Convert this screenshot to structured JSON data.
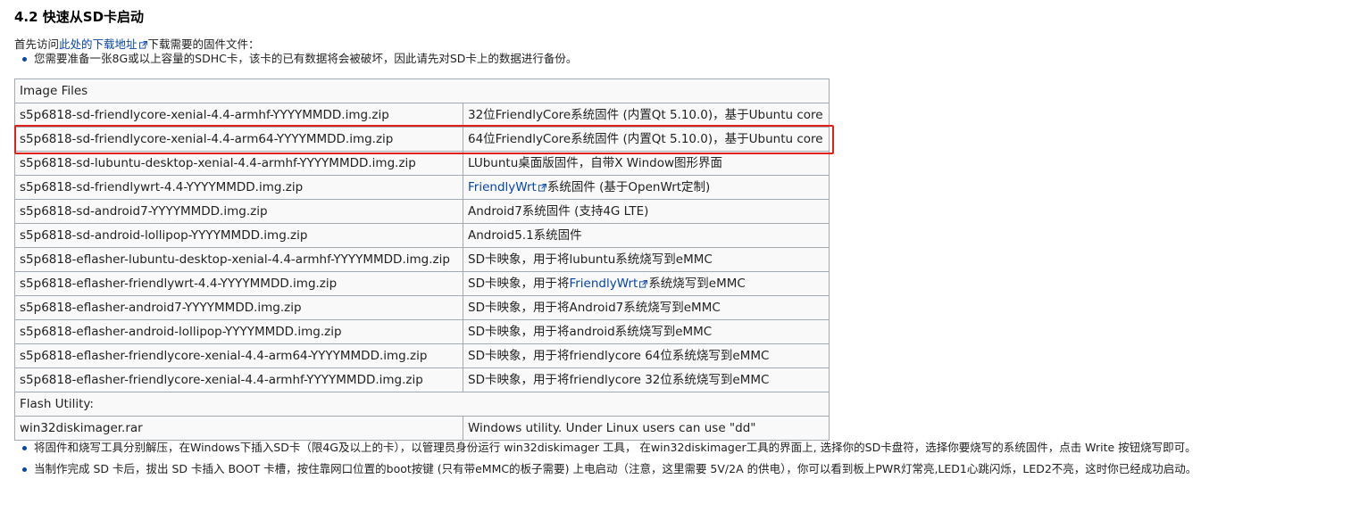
{
  "section": {
    "title": "4.2 快速从SD卡启动"
  },
  "intro": {
    "prefix": "首先访问",
    "link_text": "此处的下载地址",
    "suffix": "下载需要的固件文件："
  },
  "notes_top": [
    "您需要准备一张8G或以上容量的SDHC卡，该卡的已有数据将会被破坏，因此请先对SD卡上的数据进行备份。"
  ],
  "table": {
    "header_image_files": "Image Files",
    "image_rows": [
      {
        "file": "s5p6818-sd-friendlycore-xenial-4.4-armhf-YYYYMMDD.img.zip",
        "desc": "32位FriendlyCore系统固件 (内置Qt 5.10.0)，基于Ubuntu core"
      },
      {
        "file": "s5p6818-sd-friendlycore-xenial-4.4-arm64-YYYYMMDD.img.zip",
        "desc": "64位FriendlyCore系统固件 (内置Qt 5.10.0)，基于Ubuntu core"
      },
      {
        "file": "s5p6818-sd-lubuntu-desktop-xenial-4.4-armhf-YYYYMMDD.img.zip",
        "desc": "LUbuntu桌面版固件，自带X Window图形界面"
      },
      {
        "file": "s5p6818-sd-friendlywrt-4.4-YYYYMMDD.img.zip",
        "desc_link": "FriendlyWrt",
        "desc": "系统固件 (基于OpenWrt定制)"
      },
      {
        "file": "s5p6818-sd-android7-YYYYMMDD.img.zip",
        "desc": "Android7系统固件 (支持4G LTE)"
      },
      {
        "file": "s5p6818-sd-android-lollipop-YYYYMMDD.img.zip",
        "desc": "Android5.1系统固件"
      },
      {
        "file": "s5p6818-eflasher-lubuntu-desktop-xenial-4.4-armhf-YYYYMMDD.img.zip",
        "desc": "SD卡映象，用于将lubuntu系统烧写到eMMC"
      },
      {
        "file": "s5p6818-eflasher-friendlywrt-4.4-YYYYMMDD.img.zip",
        "desc_prefix": "SD卡映象，用于将",
        "desc_link": "FriendlyWrt",
        "desc": "系统烧写到eMMC"
      },
      {
        "file": "s5p6818-eflasher-android7-YYYYMMDD.img.zip",
        "desc": "SD卡映象，用于将Android7系统烧写到eMMC"
      },
      {
        "file": "s5p6818-eflasher-android-lollipop-YYYYMMDD.img.zip",
        "desc": "SD卡映象，用于将android系统烧写到eMMC"
      },
      {
        "file": "s5p6818-eflasher-friendlycore-xenial-4.4-arm64-YYYYMMDD.img.zip",
        "desc": "SD卡映象，用于将friendlycore 64位系统烧写到eMMC"
      },
      {
        "file": "s5p6818-eflasher-friendlycore-xenial-4.4-armhf-YYYYMMDD.img.zip",
        "desc": "SD卡映象，用于将friendlycore 32位系统烧写到eMMC"
      }
    ],
    "header_flash_utility": "Flash Utility:",
    "utility_row": {
      "file": "win32diskimager.rar",
      "desc": "Windows utility. Under Linux users can use \"dd\""
    }
  },
  "notes_bottom": [
    "将固件和烧写工具分别解压，在Windows下插入SD卡（限4G及以上的卡），以管理员身份运行 win32diskimager 工具， 在win32diskimager工具的界面上, 选择你的SD卡盘符，选择你要烧写的系统固件，点击 Write 按钮烧写即可。",
    "当制作完成 SD 卡后，拔出 SD 卡插入 BOOT 卡槽，按住靠网口位置的boot按键 (只有带eMMC的板子需要) 上电启动（注意，这里需要 5V/2A 的供电），你可以看到板上PWR灯常亮,LED1心跳闪烁，LED2不亮，这时你已经成功启动。"
  ],
  "colors": {
    "link": "#0645ad",
    "highlight_border": "#e0201a",
    "table_border": "#a2a9b1",
    "table_bg": "#f9f9f9"
  }
}
